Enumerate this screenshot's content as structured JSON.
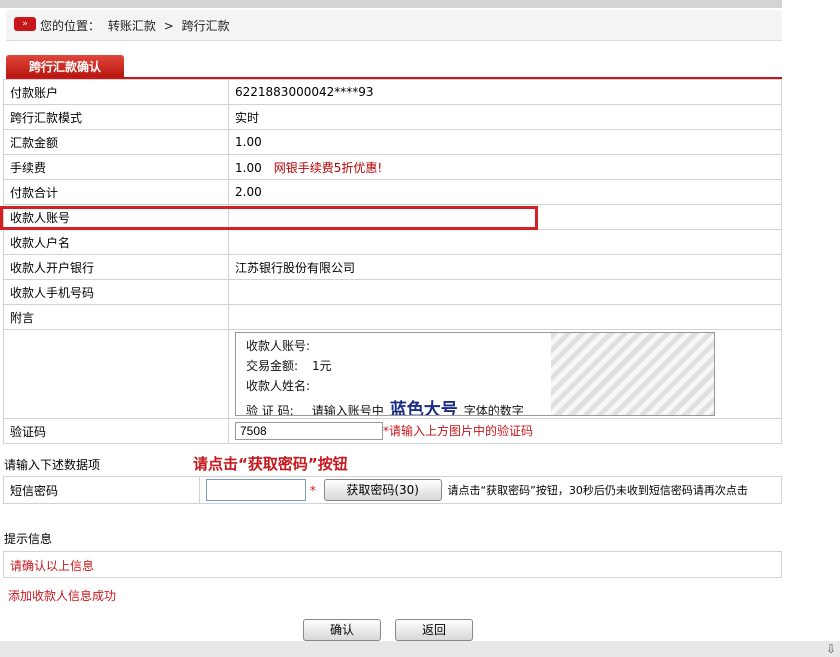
{
  "breadcrumb": {
    "prefix": "您的位置：",
    "section": "转账汇款",
    "separator": ">",
    "current": "跨行汇款"
  },
  "tab": {
    "label": "跨行汇款确认"
  },
  "form": {
    "rows": [
      {
        "label": "付款账户",
        "value": "6221883000042****93"
      },
      {
        "label": "跨行汇款模式",
        "value": "实时"
      },
      {
        "label": "汇款金额",
        "value": "1.00"
      },
      {
        "label": "手续费",
        "value": "1.00",
        "note": "网银手续费5折优惠!"
      },
      {
        "label": "付款合计",
        "value": "2.00"
      },
      {
        "label": "收款人账号",
        "value": ""
      },
      {
        "label": "收款人户名",
        "value": ""
      },
      {
        "label": "收款人开户银行",
        "value": "江苏银行股份有限公司"
      },
      {
        "label": "收款人手机号码",
        "value": ""
      },
      {
        "label": "附言",
        "value": ""
      }
    ],
    "captcha": {
      "line1": "收款人账号:",
      "line2": "交易金额:",
      "amount": "1元",
      "line3": "收款人姓名:",
      "line4_label": "验 证 码:",
      "line4_text": "请输入账号中",
      "line4_big": "蓝色大号",
      "line4_end": "字体的数字"
    },
    "verify": {
      "label": "验证码",
      "value": "7508",
      "hint": "*请输入上方图片中的验证码"
    }
  },
  "sms_section": {
    "label": "请输入下述数据项",
    "instruction": "请点击“获取密码”按钮",
    "field_label": "短信密码",
    "input_value": "",
    "star": "*",
    "button_label": "获取密码(30)",
    "hint": "请点击“获取密码”按钮，30秒后仍未收到短信密码请再次点击"
  },
  "tips": {
    "label": "提示信息",
    "message": "请确认以上信息",
    "success": "添加收款人信息成功"
  },
  "buttons": {
    "confirm": "确认",
    "back": "返回"
  },
  "colors": {
    "accent": "#c8161d",
    "captcha_blue": "#1a2c85"
  }
}
